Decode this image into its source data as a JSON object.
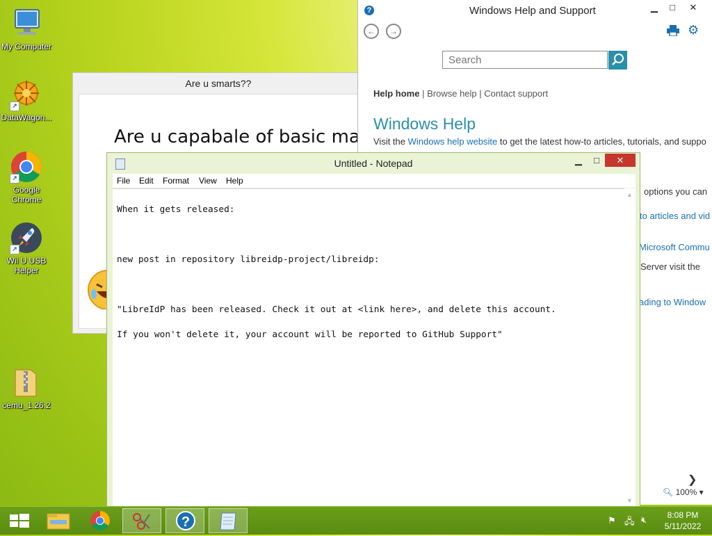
{
  "desktop": {
    "icons": [
      {
        "label": "My Computer",
        "icon": "computer-icon"
      },
      {
        "label": "DataWagon...",
        "icon": "datawagon-icon"
      },
      {
        "label": "Google Chrome",
        "icon": "chrome-icon"
      },
      {
        "label": "Wii U USB Helper",
        "icon": "rocket-icon"
      },
      {
        "label": "cemu_1.26.2",
        "icon": "zip-folder-icon"
      }
    ]
  },
  "quiz_window": {
    "title": "Are u smarts??",
    "heading": "Are u capabale of basic mat"
  },
  "help_window": {
    "title": "Windows Help and Support",
    "search_placeholder": "Search",
    "links": {
      "help_home": "Help home",
      "browse_help": "Browse help",
      "contact_support": "Contact support",
      "separator": "|"
    },
    "section_title": "Windows Help",
    "intro_prefix": "Visit the ",
    "intro_link": "Windows help website",
    "intro_suffix": " to get the latest how-to articles, tutorials, and suppo",
    "partial_lines": [
      "options you can",
      "to articles and vid",
      "Microsoft Commu",
      "Server visit the",
      "ading to Window"
    ],
    "zoom": "100%"
  },
  "notepad": {
    "title": "Untitled - Notepad",
    "menu": [
      "File",
      "Edit",
      "Format",
      "View",
      "Help"
    ],
    "lines": [
      "When it gets released:",
      "",
      "new post in repository libreidp-project/libreidp:",
      "",
      "\"LibreIdP has been released. Check it out at <link here>, and delete this account.",
      "If you won't delete it, your account will be reported to GitHub Support\""
    ]
  },
  "taskbar": {
    "time": "8:08 PM",
    "date": "5/11/2022"
  },
  "colors": {
    "accent_blue": "#1a6fb3",
    "help_teal": "#2a8fa8",
    "close_red": "#c7362c",
    "taskbar_green": "#5f9414"
  }
}
